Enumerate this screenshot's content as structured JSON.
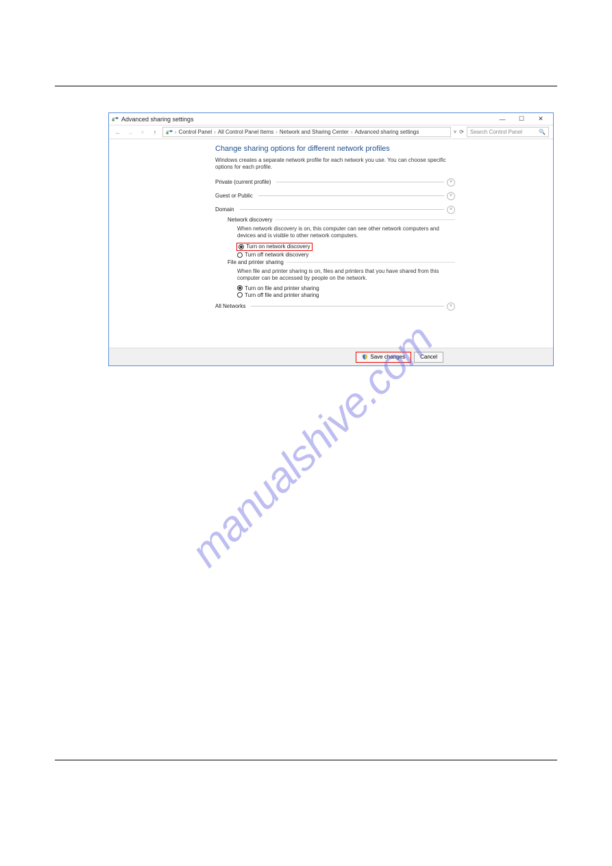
{
  "window": {
    "title": "Advanced sharing settings",
    "breadcrumbs": [
      "Control Panel",
      "All Control Panel Items",
      "Network and Sharing Center",
      "Advanced sharing settings"
    ],
    "search_placeholder": "Search Control Panel"
  },
  "content": {
    "heading": "Change sharing options for different network profiles",
    "description": "Windows creates a separate network profile for each network you use. You can choose specific options for each profile.",
    "profiles": {
      "private": "Private (current profile)",
      "guest": "Guest or Public",
      "domain": "Domain",
      "all": "All Networks"
    },
    "domain_section": {
      "network_discovery": {
        "heading": "Network discovery",
        "text": "When network discovery is on, this computer can see other network computers and devices and is visible to other network computers.",
        "option_on": "Turn on network discovery",
        "option_off": "Turn off network discovery"
      },
      "file_printer": {
        "heading": "File and printer sharing",
        "text": "When file and printer sharing is on, files and printers that you have shared from this computer can be accessed by people on the network.",
        "option_on": "Turn on file and printer sharing",
        "option_off": "Turn off file and printer sharing"
      }
    }
  },
  "footer": {
    "save": "Save changes",
    "cancel": "Cancel"
  },
  "watermark": "manualshive.com"
}
